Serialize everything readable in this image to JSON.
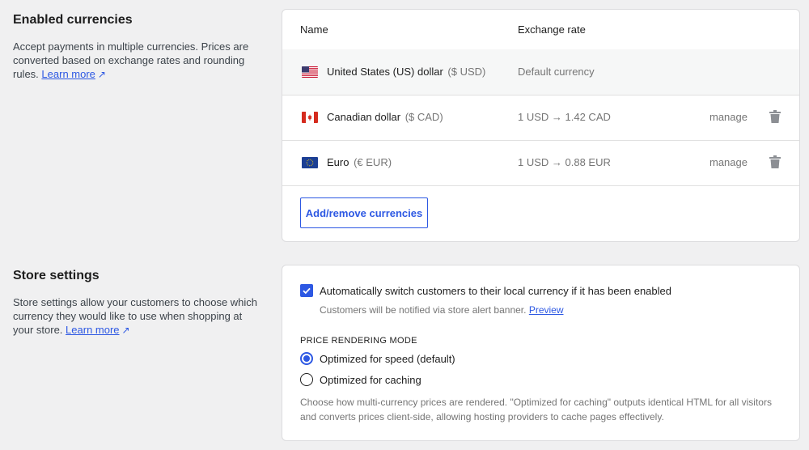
{
  "currencies_section": {
    "title": "Enabled currencies",
    "description": "Accept payments in multiple currencies. Prices are converted based on exchange rates and rounding rules.",
    "learn_more": "Learn more",
    "table": {
      "headers": {
        "name": "Name",
        "rate": "Exchange rate"
      },
      "rows": [
        {
          "flag_icon": "us-flag-icon",
          "name": "United States (US) dollar",
          "code": "($ USD)",
          "rate": "Default currency",
          "manage": "",
          "deletable": false
        },
        {
          "flag_icon": "ca-flag-icon",
          "name": "Canadian dollar",
          "code": "($ CAD)",
          "rate": "1 USD → 1.42 CAD",
          "manage": "manage",
          "deletable": true
        },
        {
          "flag_icon": "eu-flag-icon",
          "name": "Euro",
          "code": "(€ EUR)",
          "rate": "1 USD → 0.88 EUR",
          "manage": "manage",
          "deletable": true
        }
      ]
    },
    "add_button": "Add/remove currencies"
  },
  "store_section": {
    "title": "Store settings",
    "description": "Store settings allow your customers to choose which currency they would like to use when shopping at your store.",
    "learn_more": "Learn more",
    "auto_switch": {
      "checked": true,
      "label": "Automatically switch customers to their local currency if it has been enabled",
      "help": "Customers will be notified via store alert banner.",
      "preview_link": "Preview"
    },
    "price_mode": {
      "heading": "PRICE RENDERING MODE",
      "options": [
        {
          "label": "Optimized for speed (default)",
          "selected": true
        },
        {
          "label": "Optimized for caching",
          "selected": false
        }
      ],
      "help_line1": "Choose how multi-currency prices are rendered. \"Optimized for caching\" outputs identical HTML for all visitors",
      "help_line2": "and converts prices client-side, allowing hosting providers to cache pages effectively."
    }
  },
  "colors": {
    "accent": "#2d58e3",
    "page_bg": "#f0f0f1",
    "muted": "#757575"
  }
}
